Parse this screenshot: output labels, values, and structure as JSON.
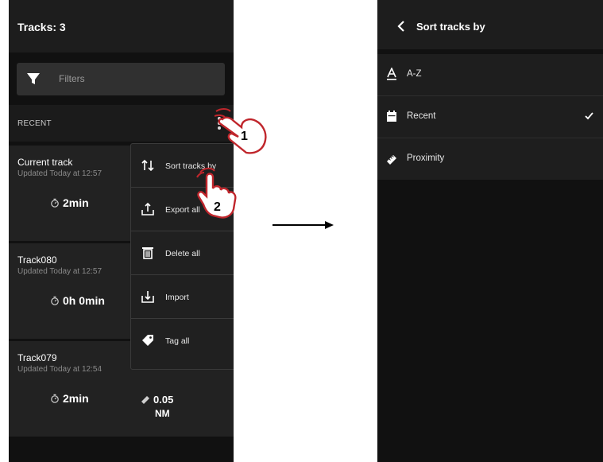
{
  "left_screen": {
    "title": "Tracks: 3",
    "filter_label": "Filters",
    "section_label": "RECENT",
    "tracks": [
      {
        "name": "Current track",
        "updated": "Updated Today at 12:57",
        "duration": "2min"
      },
      {
        "name": "Track080",
        "updated": "Updated Today at 12:57",
        "duration": "0h 0min"
      },
      {
        "name": "Track079",
        "updated": "Updated Today at 12:54",
        "duration": "2min",
        "distance": "0.05",
        "distance_unit": "NM"
      }
    ],
    "menu": [
      {
        "label": "Sort tracks by",
        "icon": "sort-arrows-icon"
      },
      {
        "label": "Export all",
        "icon": "export-icon"
      },
      {
        "label": "Delete all",
        "icon": "trash-icon"
      },
      {
        "label": "Import",
        "icon": "import-icon"
      },
      {
        "label": "Tag all",
        "icon": "tag-icon"
      }
    ]
  },
  "annotations": {
    "step_1": "1",
    "step_2": "2"
  },
  "right_screen": {
    "title": "Sort tracks by",
    "options": [
      {
        "label": "A-Z",
        "icon": "alphabet-icon",
        "selected": false
      },
      {
        "label": "Recent",
        "icon": "calendar-icon",
        "selected": true
      },
      {
        "label": "Proximity",
        "icon": "ruler-icon",
        "selected": false
      }
    ]
  },
  "colors": {
    "screen_background": "#111111",
    "card_background": "#222222",
    "text_primary": "#ffffff",
    "text_secondary": "#8a8a8a",
    "hand_highlight": "#c0262c"
  }
}
